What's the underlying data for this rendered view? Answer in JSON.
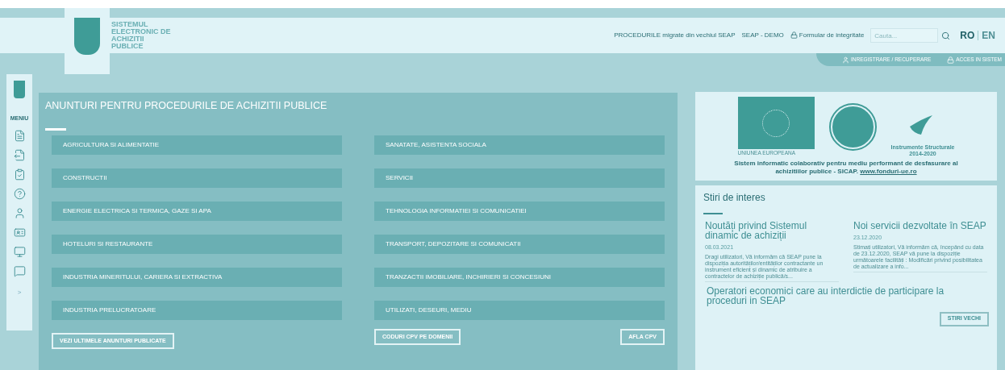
{
  "logo": {
    "lines": [
      "SISTEMUL",
      "ELECTRONIC DE",
      "ACHIZITII",
      "PUBLICE"
    ]
  },
  "top_links": [
    {
      "label": "PROCEDURILE migrate din vechiul SEAP",
      "kind": "plain"
    },
    {
      "label": "SEAP - DEMO",
      "kind": "plain"
    },
    {
      "label": "Formular de integritate",
      "kind": "lock"
    }
  ],
  "search": {
    "placeholder": "Cauta..."
  },
  "languages": [
    {
      "label": "RO",
      "selected": true
    },
    {
      "label": "EN",
      "selected": false
    }
  ],
  "account_links": [
    {
      "label": "INREGISTRARE / RECUPERARE",
      "kind": "user"
    },
    {
      "label": "ACCES IN SISTEM",
      "kind": "lock"
    }
  ],
  "sidebar": {
    "menu_label": "MENIU",
    "items": [
      {
        "kind": "document"
      },
      {
        "kind": "export"
      },
      {
        "kind": "clipboard"
      },
      {
        "kind": "help"
      },
      {
        "kind": "person"
      },
      {
        "kind": "id"
      },
      {
        "kind": "monitor"
      },
      {
        "kind": "chat"
      }
    ],
    "expand": ">"
  },
  "announcements": {
    "title": "ANUNTURI PENTRU PROCEDURILE DE ACHIZITII PUBLICE",
    "categories": [
      "AGRICULTURA SI ALIMENTATIE",
      "SANATATE, ASISTENTA SOCIALA",
      "CONSTRUCTII",
      "SERVICII",
      "ENERGIE ELECTRICA SI TERMICA, GAZE SI APA",
      "TEHNOLOGIA INFORMATIEI SI COMUNICATIEI",
      "HOTELURI SI RESTAURANTE",
      "TRANSPORT, DEPOZITARE SI COMUNICATII",
      "INDUSTRIA MINERITULUI, CARIERA SI EXTRACTIVA",
      "TRANZACTII IMOBILIARE, INCHIRIERI SI CONCESIUNI",
      "INDUSTRIA PRELUCRATOARE",
      "UTILIZATI, DESEURI, MEDIU"
    ],
    "buttons": [
      "VEZI ULTIMELE ANUNTURI PUBLICATE",
      "CODURI CPV PE DOMENII",
      "AFLA CPV"
    ]
  },
  "banner": {
    "eu_label": "UNIUNEA EUROPEANA",
    "is_label": [
      "Instrumente Structurale",
      "2014-2020"
    ],
    "text": "Sistem informatic colaborativ pentru mediu performant de desfasurare al achizitiilor publice - SICAP.",
    "link": "www.fonduri-ue.ro"
  },
  "news": {
    "title": "Stiri de interes",
    "items": [
      {
        "title": "Noutăți privind Sistemul dinamic de achiziții",
        "date": "08.03.2021",
        "excerpt": "Dragi utilizatori, Vă informăm că SEAP pune la dispoziția autorităților/entităților contractante un instrument eficient și dinamic de atribuire a contractelor de achiziție publică/s..."
      },
      {
        "title": "Noi servicii dezvoltate în SEAP",
        "date": "23.12.2020",
        "excerpt": "Stimați utilizatori, Vă informăm că, începând cu data de 23.12.2020, SEAP vă pune la dispoziție următoarele facilități : Modificări privind posibilitatea de actualizare a info..."
      }
    ],
    "headline": "Operatori economici care au interdictie de participare la proceduri in SEAP",
    "button": "STIRI VECHI"
  }
}
